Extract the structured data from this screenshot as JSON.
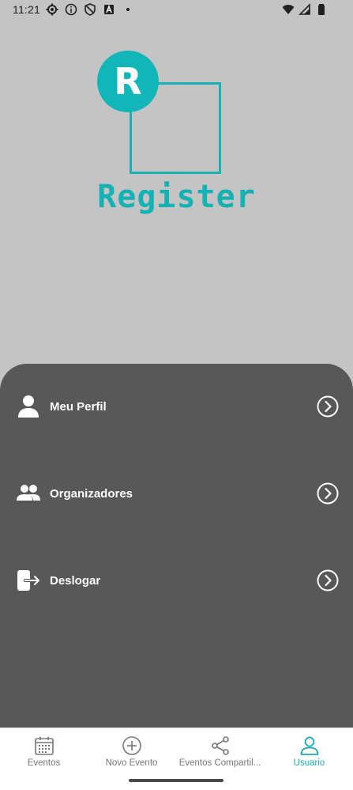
{
  "status_bar": {
    "time": "11:21",
    "left_icons": [
      "gear-icon",
      "info-icon",
      "shield-icon",
      "a-box-icon",
      "dot-icon"
    ],
    "right_icons": [
      "wifi-icon",
      "signal-icon",
      "battery-icon"
    ]
  },
  "logo": {
    "initial": "R",
    "title": "Register",
    "color": "#14b2b5"
  },
  "menu": {
    "items": [
      {
        "label": "Meu Perfil",
        "icon": "user-icon"
      },
      {
        "label": "Organizadores",
        "icon": "users-icon"
      },
      {
        "label": "Deslogar",
        "icon": "logout-icon"
      }
    ],
    "chevron_icon": "chevron-right-circle-icon"
  },
  "bottom_nav": {
    "items": [
      {
        "label": "Eventos",
        "icon": "calendar-icon",
        "active": false
      },
      {
        "label": "Novo Evento",
        "icon": "plus-circle-icon",
        "active": false
      },
      {
        "label": "Eventos Compartil...",
        "icon": "share-icon",
        "active": false
      },
      {
        "label": "Usuario",
        "icon": "user-outline-icon",
        "active": true
      }
    ],
    "active_color": "#1aa9b3"
  }
}
